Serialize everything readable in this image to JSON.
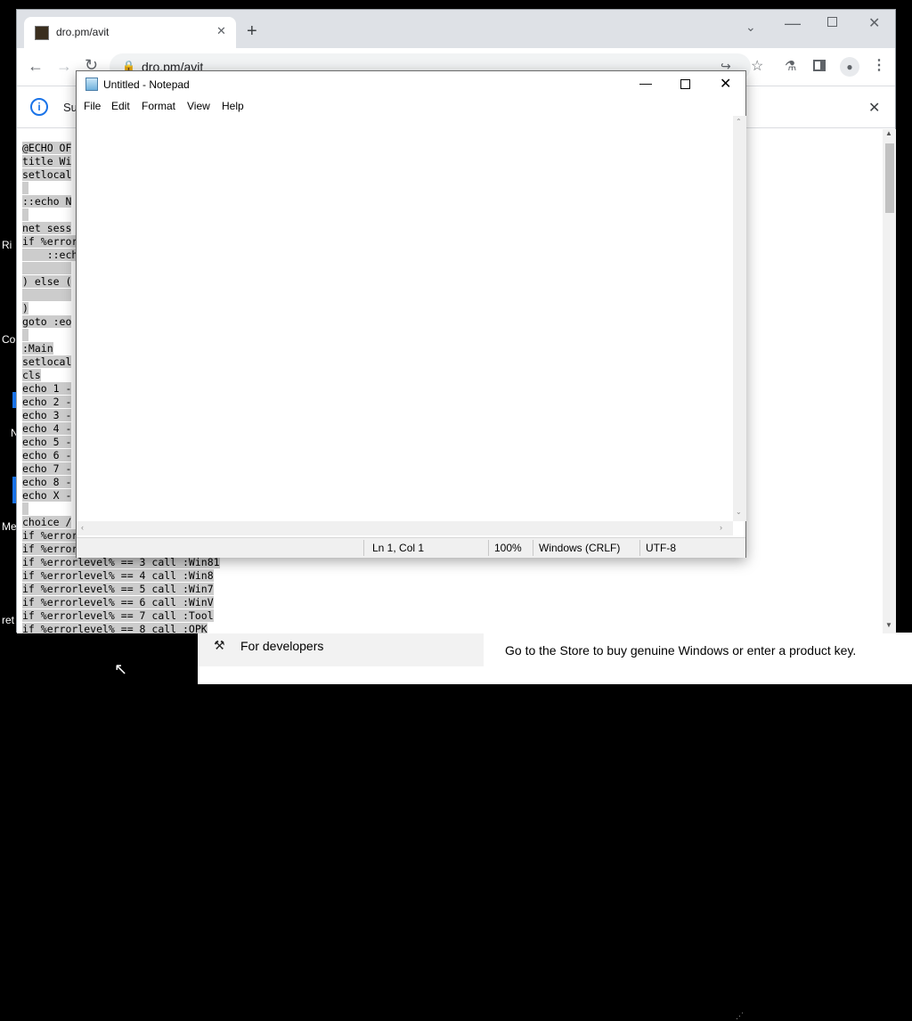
{
  "desktop": {
    "fragments": [
      "Ri",
      "Co",
      "N",
      "Me",
      "ret"
    ]
  },
  "browser": {
    "tab": {
      "title": "dro.pm/avit",
      "close_icon": "close-icon"
    },
    "new_tab_label": "+",
    "address": "dro.pm/avit",
    "infobar_text": "Su",
    "content": {
      "code_lines": [
        "@ECHO OF",
        "title Wi",
        "setlocal",
        " ",
        "::echo N",
        " ",
        "net sess",
        "if %error",
        "    ::ech",
        "        ",
        ") else (",
        "        ",
        ")",
        "goto :eo",
        " ",
        ":Main",
        "setlocal",
        "cls",
        "echo 1 -",
        "echo 2 -",
        "echo 3 -",
        "echo 4 -",
        "echo 5 -",
        "echo 6 -",
        "echo 7 -",
        "echo 8 -",
        "echo X -",
        " ",
        "choice /",
        "if %error",
        "if %error",
        "if %errorlevel% == 3 call :Win81",
        "if %errorlevel% == 4 call :Win8",
        "if %errorlevel% == 5 call :Win7",
        "if %errorlevel% == 6 call :WinV",
        "if %errorlevel% == 7 call :Tool",
        "if %errorlevel% == 8 call :OPK"
      ]
    }
  },
  "notepad": {
    "title": "Untitled - Notepad",
    "menu": [
      "File",
      "Edit",
      "Format",
      "View",
      "Help"
    ],
    "content": "",
    "status": {
      "position": "Ln 1, Col 1",
      "zoom": "100%",
      "line_endings": "Windows (CRLF)",
      "encoding": "UTF-8"
    }
  },
  "settings": {
    "nav_item": "For developers",
    "store_message": "Go to the Store to buy genuine Windows or enter a product key."
  }
}
